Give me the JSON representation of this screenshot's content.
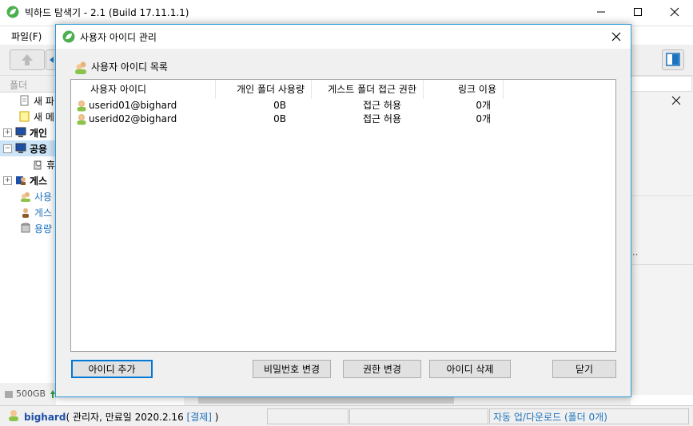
{
  "app": {
    "title": "빅하드 탐색기 - 2.1 (Build 17.11.1.1)",
    "menu": [
      "파일(F)"
    ],
    "accent_color": "#2b9bd6"
  },
  "left_panel": {
    "header": "폴더",
    "items": [
      {
        "label": "새 파",
        "icon": "new-file-icon"
      },
      {
        "label": "새 메",
        "icon": "memo-icon"
      },
      {
        "label": "개인",
        "icon": "computer-icon",
        "bold": true
      },
      {
        "label": "공용",
        "icon": "computer-icon",
        "bold": true,
        "selected": true
      },
      {
        "label": "휴",
        "icon": "trash-icon"
      },
      {
        "label": "게스",
        "icon": "guest-icon",
        "bold": true
      },
      {
        "label": "사용",
        "icon": "users-icon",
        "link": true
      },
      {
        "label": "게스",
        "icon": "guest-user-icon",
        "link": true
      },
      {
        "label": "용량",
        "icon": "storage-icon",
        "link": true
      }
    ],
    "storage_label": "500GB"
  },
  "right_panel": {
    "ellipsis": "..."
  },
  "statusbar": {
    "username": "bighard",
    "info": "( 관리자, 만료일 2020.2.16 ",
    "payment_link": "[결제]",
    "info_end": " )",
    "sync_text": "자동 업/다운로드 (폴더 0개)"
  },
  "dialog": {
    "title": "사용자 아이디 관리",
    "list_caption": "사용자 아이디 목록",
    "columns": [
      "사용자 아이디",
      "개인 폴더 사용량",
      "게스트 폴더 접근 권한",
      "링크 이용"
    ],
    "rows": [
      {
        "id": "userid01@bighard",
        "usage": "0B",
        "permission": "접근 허용",
        "links": "0개"
      },
      {
        "id": "userid02@bighard",
        "usage": "0B",
        "permission": "접근 허용",
        "links": "0개"
      }
    ],
    "buttons": {
      "add": "아이디 추가",
      "change_password": "비밀번호 변경",
      "change_permission": "권한 변경",
      "delete": "아이디 삭제",
      "close": "닫기"
    }
  }
}
